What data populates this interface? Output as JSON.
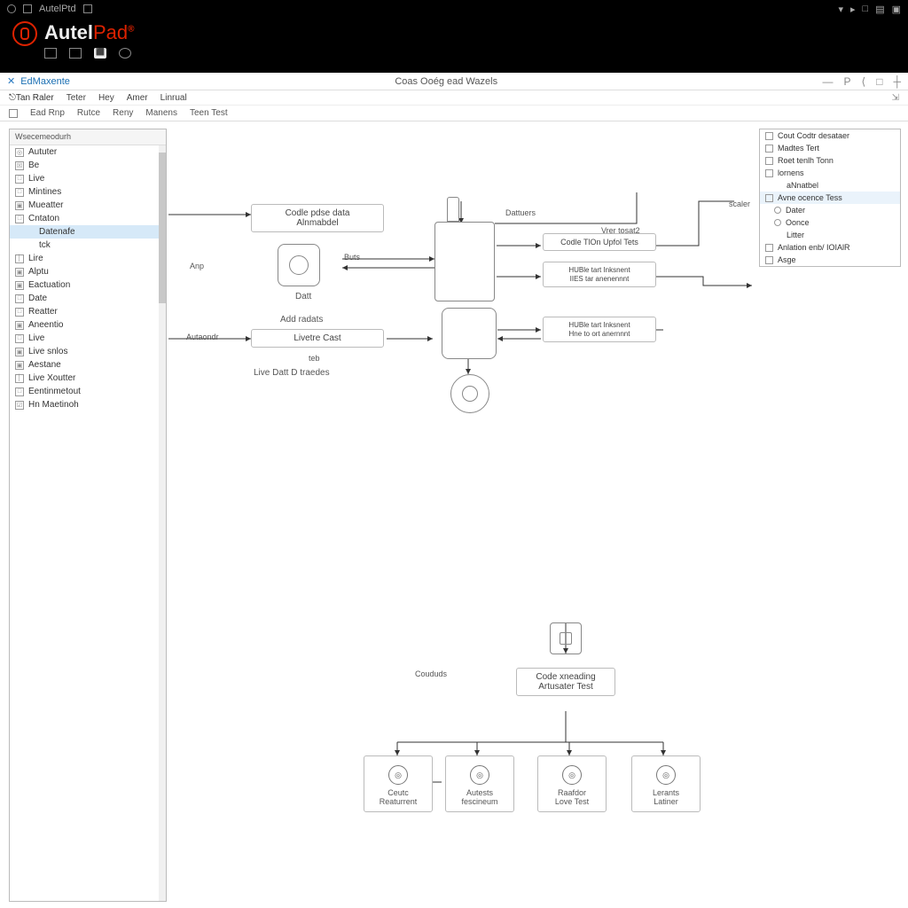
{
  "titlebar": {
    "appname": "AutelPtd",
    "icons": [
      "▾",
      "▸",
      "□",
      "▤",
      "▣"
    ]
  },
  "brand": {
    "name_a": "Autel",
    "name_b": "Pad",
    "sup": "®"
  },
  "subheader": {
    "title": "EdMaxente",
    "center": "Coas Ooég ead Wazels"
  },
  "menubar": [
    "⎋Tan Raler",
    "Teter",
    "Hey",
    "Amer",
    "Linrual"
  ],
  "toolbar": [
    "Ead Rnp",
    "Rutce",
    "Reny",
    "Manens",
    "Teen Test"
  ],
  "leftpanel": {
    "header": "Wsecemeodurh",
    "items": [
      {
        "icon": "◎",
        "label": "Aututer"
      },
      {
        "icon": "☒",
        "label": "Be"
      },
      {
        "icon": "□",
        "label": "Live"
      },
      {
        "icon": "□",
        "label": "Mintines"
      },
      {
        "icon": "▣",
        "label": "Mueatter"
      },
      {
        "icon": "□",
        "label": "Cntaton"
      },
      {
        "icon": "",
        "label": "Datenafe",
        "sel": true,
        "indent": true
      },
      {
        "icon": "",
        "label": "tck",
        "indent": true
      },
      {
        "icon": "│",
        "label": "Lire"
      },
      {
        "icon": "▣",
        "label": "Alptu"
      },
      {
        "icon": "▣",
        "label": "Eactuation"
      },
      {
        "icon": "□",
        "label": "Date"
      },
      {
        "icon": "□",
        "label": "Reatter"
      },
      {
        "icon": "▣",
        "label": "Aneentio"
      },
      {
        "icon": "□",
        "label": "Live"
      },
      {
        "icon": "▣",
        "label": "Live snlos"
      },
      {
        "icon": "▣",
        "label": "Aestane"
      },
      {
        "icon": "│",
        "label": "Live Xoutter"
      },
      {
        "icon": "□",
        "label": "Eentinmetout"
      },
      {
        "icon": "☑",
        "label": "Hn Maetinoh"
      }
    ]
  },
  "rightpanel": {
    "items": [
      {
        "type": "ico",
        "label": "Cout Codtr desataer"
      },
      {
        "type": "ico",
        "label": "Madtes Tert"
      },
      {
        "type": "ico",
        "label": "Roet tenlh Tonn"
      },
      {
        "type": "ico",
        "label": "lornens"
      },
      {
        "type": "txt",
        "label": "aNnatbel",
        "indent": true
      },
      {
        "type": "ico",
        "label": "Avne ocence Tess",
        "sel": true
      },
      {
        "type": "rad",
        "label": "Dater",
        "indent": true
      },
      {
        "type": "rad",
        "label": "Oonce",
        "indent": true
      },
      {
        "type": "txt",
        "label": "Litter",
        "indent": true
      },
      {
        "type": "ico",
        "label": "Anlation enb/ IOIAlR"
      },
      {
        "type": "ico",
        "label": "Asge"
      }
    ]
  },
  "canvas": {
    "node1": {
      "l1": "Codle pdse data",
      "l2": "Alnmabdel"
    },
    "node1_sub": "Datt",
    "node2": "Livetre Cast",
    "node2_top": "Add radats",
    "node2_sub1": "teb",
    "node2_sub2": "Live Datt D traedes",
    "lbl_anp": "Anp",
    "lbl_auto": "Autaondr",
    "lbl_buts": "Buts",
    "lbl_dattuers": "Dattuers",
    "lbl_view": "Vrer tosat2",
    "plate1": "Codle TlOn Upfol Tets",
    "plate2a": "HUBle tart Inksnent",
    "plate2b": "IIES tar anenennnt",
    "plate3a": "HUBle tart Inksnent",
    "plate3b": "Hne to ort anernnnt",
    "lbl_couda": "Coududs",
    "node3": {
      "l1": "Code xneading",
      "l2": "Artusater Test"
    },
    "b1": {
      "t": "Ceutc",
      "b": "Reaturrent"
    },
    "b2": {
      "t": "Autests",
      "b": "fescineum"
    },
    "b3": {
      "t": "Raafdor",
      "b": "Love Test"
    },
    "b4": {
      "t": "Lerants",
      "b": "Latiner"
    },
    "lbl_scaler": "scaler"
  }
}
